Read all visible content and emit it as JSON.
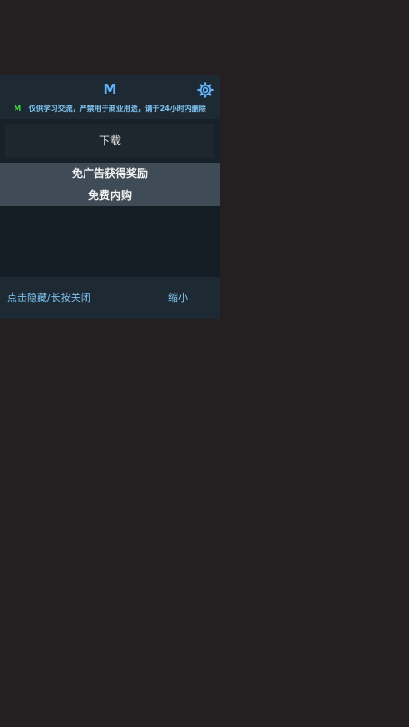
{
  "header": {
    "title": "M",
    "settings_icon": "gear-icon"
  },
  "notice": {
    "tag": "M",
    "text": " | 仅供学习交流，严禁用于商业用途，请于24小时内删除"
  },
  "actions": {
    "download_label": "下载"
  },
  "promo": {
    "line1": "免广告获得奖励",
    "line2": "免费内购"
  },
  "footer": {
    "hide_close_label": "点击隐藏/长按关闭",
    "minimize_label": "缩小"
  },
  "colors": {
    "accent": "#62b3ff",
    "notice_text": "#7fc4f2",
    "tag_green": "#3ddc3d",
    "panel_bg": "#182129",
    "page_bg": "#242021"
  }
}
